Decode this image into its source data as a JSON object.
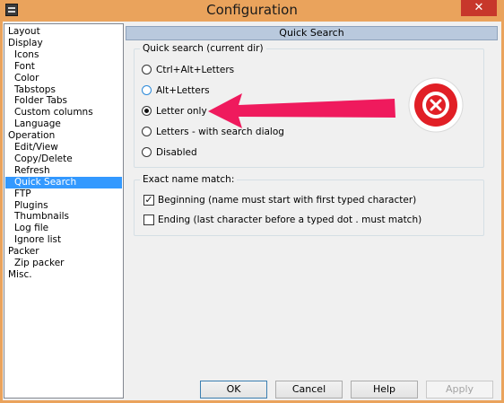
{
  "window": {
    "title": "Configuration",
    "close_symbol": "✕"
  },
  "tree": {
    "items": [
      {
        "label": "Layout",
        "level": 0
      },
      {
        "label": "Display",
        "level": 0
      },
      {
        "label": "Icons",
        "level": 1
      },
      {
        "label": "Font",
        "level": 1
      },
      {
        "label": "Color",
        "level": 1
      },
      {
        "label": "Tabstops",
        "level": 1
      },
      {
        "label": "Folder Tabs",
        "level": 1
      },
      {
        "label": "Custom columns",
        "level": 1
      },
      {
        "label": "Language",
        "level": 1
      },
      {
        "label": "Operation",
        "level": 0
      },
      {
        "label": "Edit/View",
        "level": 1
      },
      {
        "label": "Copy/Delete",
        "level": 1
      },
      {
        "label": "Refresh",
        "level": 1
      },
      {
        "label": "Quick Search",
        "level": 1,
        "selected": true
      },
      {
        "label": "FTP",
        "level": 1
      },
      {
        "label": "Plugins",
        "level": 1
      },
      {
        "label": "Thumbnails",
        "level": 1
      },
      {
        "label": "Log file",
        "level": 1
      },
      {
        "label": "Ignore list",
        "level": 1
      },
      {
        "label": "Packer",
        "level": 0
      },
      {
        "label": "Zip packer",
        "level": 1
      },
      {
        "label": "Misc.",
        "level": 0
      }
    ]
  },
  "page": {
    "header": "Quick Search",
    "quick_search_group": {
      "title": "Quick search (current dir)",
      "options": [
        {
          "label": "Ctrl+Alt+Letters",
          "checked": false
        },
        {
          "label": "Alt+Letters",
          "checked": false
        },
        {
          "label": "Letter only",
          "checked": true
        },
        {
          "label": "Letters - with search dialog",
          "checked": false
        },
        {
          "label": "Disabled",
          "checked": false
        }
      ]
    },
    "exact_match_group": {
      "title": "Exact name match:",
      "options": [
        {
          "label": "Beginning (name must start with first typed character)",
          "checked": true
        },
        {
          "label": "Ending (last character before a typed dot . must match)",
          "checked": false
        }
      ]
    }
  },
  "buttons": {
    "ok": "OK",
    "cancel": "Cancel",
    "help": "Help",
    "apply": "Apply"
  },
  "annotation": {
    "arrow_color": "#ef1a5d",
    "badge_color": "#e11f26",
    "icon": "x-circle-icon"
  }
}
